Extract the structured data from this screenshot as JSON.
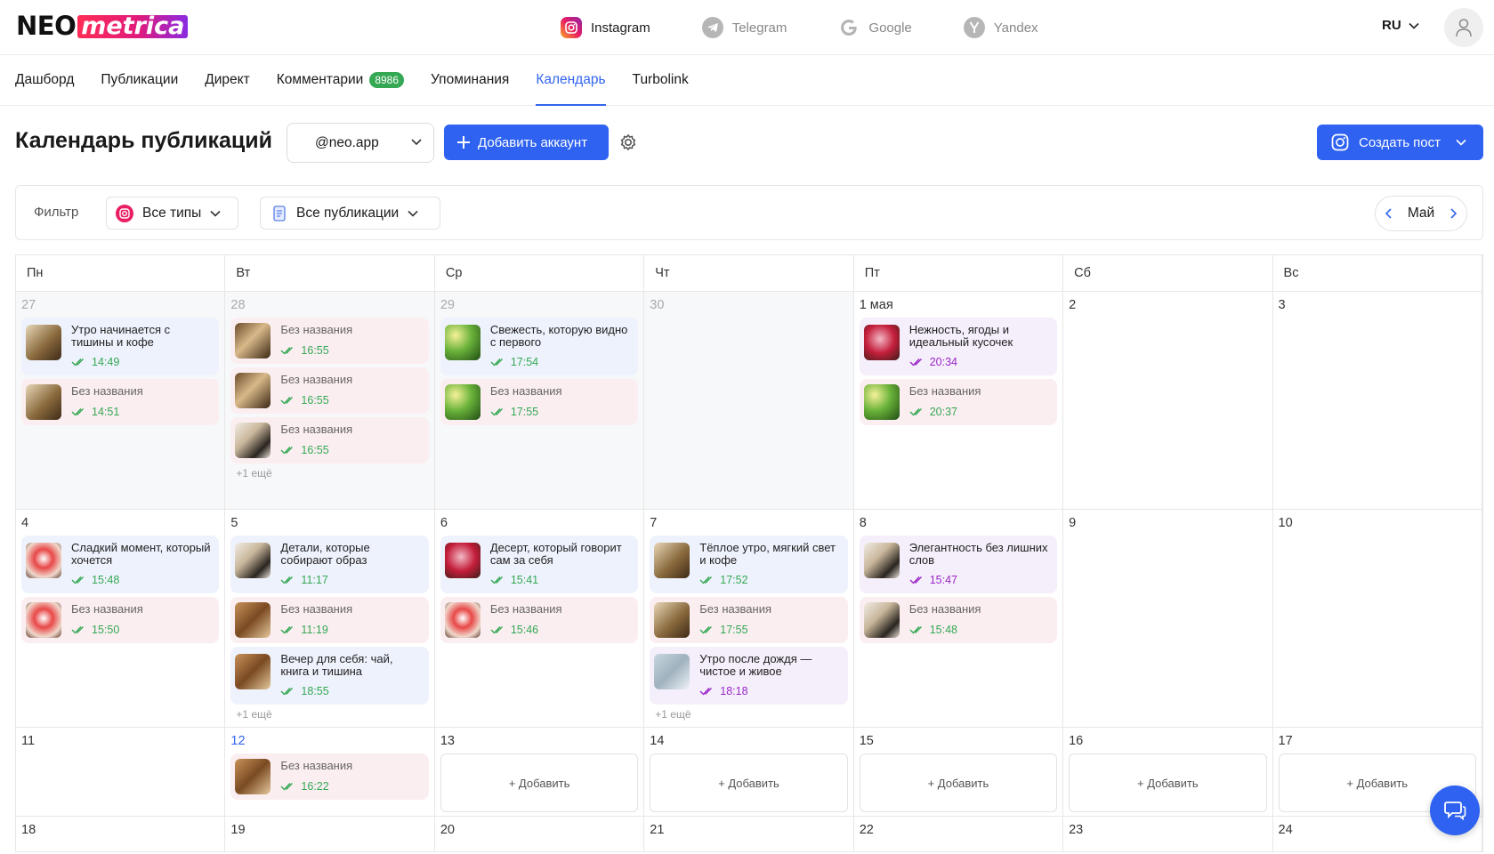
{
  "brand": {
    "part1": "NEO",
    "part2": "metrica"
  },
  "platforms": [
    {
      "label": "Instagram",
      "icon": "instagram-icon",
      "active": true
    },
    {
      "label": "Telegram",
      "icon": "telegram-icon"
    },
    {
      "label": "Google",
      "icon": "google-icon"
    },
    {
      "label": "Yandex",
      "icon": "yandex-icon"
    }
  ],
  "lang": "RU",
  "nav": {
    "dashboard": "Дашборд",
    "publications": "Публикации",
    "direct": "Директ",
    "comments": "Комментарии",
    "comments_badge": "8986",
    "mentions": "Упоминания",
    "calendar": "Календарь",
    "turbolink": "Turbolink"
  },
  "page": {
    "title": "Календарь публикаций",
    "account": "@neo.app",
    "add_account": "Добавить аккаунт",
    "create_post": "Создать пост"
  },
  "filter": {
    "label": "Фильтр",
    "types": "Все типы",
    "pubs": "Все публикации",
    "month": "Май"
  },
  "weekdays": [
    "Пн",
    "Вт",
    "Ср",
    "Чт",
    "Пт",
    "Сб",
    "Вс"
  ],
  "weeks": [
    {
      "height": "h1",
      "days": [
        {
          "n": "27",
          "past": true,
          "posts": [
            {
              "title": "Утро начинается с тишины и кофе",
              "time": "14:49",
              "tone": "blue",
              "thumb": "coffee"
            },
            {
              "title": "Без названия",
              "time": "14:51",
              "tone": "pink",
              "thumb": "coffee",
              "noname": true
            }
          ]
        },
        {
          "n": "28",
          "past": true,
          "more": "+1 ещё",
          "posts": [
            {
              "title": "Без названия",
              "time": "16:55",
              "tone": "pink",
              "thumb": "coffee2",
              "noname": true
            },
            {
              "title": "Без названия",
              "time": "16:55",
              "tone": "pink",
              "thumb": "coffee2",
              "noname": true
            },
            {
              "title": "Без названия",
              "time": "16:55",
              "tone": "pink",
              "thumb": "glasses",
              "noname": true
            }
          ]
        },
        {
          "n": "29",
          "past": true,
          "posts": [
            {
              "title": "Свежесть, которую видно с первого",
              "time": "17:54",
              "tone": "blue",
              "thumb": "leaf"
            },
            {
              "title": "Без названия",
              "time": "17:55",
              "tone": "pink",
              "thumb": "leaf",
              "noname": true
            }
          ]
        },
        {
          "n": "30",
          "past": true,
          "posts": []
        },
        {
          "n": "1 мая",
          "posts": [
            {
              "title": "Нежность, ягоды и идеальный кусочек",
              "time": "20:34",
              "tone": "purple",
              "thumb": "cake",
              "purple": true
            },
            {
              "title": "Без названия",
              "time": "20:37",
              "tone": "pink",
              "thumb": "leaf",
              "noname": true
            }
          ]
        },
        {
          "n": "2",
          "posts": []
        },
        {
          "n": "3",
          "posts": []
        }
      ]
    },
    {
      "height": "h2",
      "days": [
        {
          "n": "4",
          "posts": [
            {
              "title": "Сладкий момент, который хочется",
              "time": "15:48",
              "tone": "blue",
              "thumb": "straw"
            },
            {
              "title": "Без названия",
              "time": "15:50",
              "tone": "pink",
              "thumb": "straw",
              "noname": true
            }
          ]
        },
        {
          "n": "5",
          "more": "+1 ещё",
          "posts": [
            {
              "title": "Детали, которые собирают образ",
              "time": "11:17",
              "tone": "blue",
              "thumb": "glasses"
            },
            {
              "title": "Без названия",
              "time": "11:19",
              "tone": "pink",
              "thumb": "book",
              "noname": true
            },
            {
              "title": "Вечер для себя: чай, книга и тишина",
              "time": "18:55",
              "tone": "blue",
              "thumb": "book"
            }
          ]
        },
        {
          "n": "6",
          "posts": [
            {
              "title": "Десерт, который говорит сам за себя",
              "time": "15:41",
              "tone": "blue",
              "thumb": "cake"
            },
            {
              "title": "Без названия",
              "time": "15:46",
              "tone": "pink",
              "thumb": "straw",
              "noname": true
            }
          ]
        },
        {
          "n": "7",
          "more": "+1 ещё",
          "posts": [
            {
              "title": "Тёплое утро, мягкий свет и кофе",
              "time": "17:52",
              "tone": "blue",
              "thumb": "coffee"
            },
            {
              "title": "Без названия",
              "time": "17:55",
              "tone": "pink",
              "thumb": "coffee",
              "noname": true
            },
            {
              "title": "Утро после дождя — чистое и живое",
              "time": "18:18",
              "tone": "purple",
              "thumb": "rain",
              "purple": true
            }
          ]
        },
        {
          "n": "8",
          "posts": [
            {
              "title": "Элегантность без лишних слов",
              "time": "15:47",
              "tone": "purple",
              "thumb": "glasses",
              "purple": true
            },
            {
              "title": "Без названия",
              "time": "15:48",
              "tone": "pink",
              "thumb": "glasses",
              "noname": true
            }
          ]
        },
        {
          "n": "9",
          "posts": []
        },
        {
          "n": "10",
          "posts": []
        }
      ]
    },
    {
      "height": "h3",
      "days": [
        {
          "n": "11",
          "posts": []
        },
        {
          "n": "12",
          "today": true,
          "posts": [
            {
              "title": "Без названия",
              "time": "16:22",
              "tone": "pink",
              "thumb": "book",
              "noname": true
            }
          ]
        },
        {
          "n": "13",
          "add": "+ Добавить",
          "posts": []
        },
        {
          "n": "14",
          "add": "+ Добавить",
          "posts": []
        },
        {
          "n": "15",
          "add": "+ Добавить",
          "posts": []
        },
        {
          "n": "16",
          "add": "+ Добавить",
          "posts": []
        },
        {
          "n": "17",
          "add": "+ Добавить",
          "posts": []
        }
      ]
    },
    {
      "height": "h4",
      "days": [
        {
          "n": "18",
          "posts": []
        },
        {
          "n": "19",
          "posts": []
        },
        {
          "n": "20",
          "posts": []
        },
        {
          "n": "21",
          "posts": []
        },
        {
          "n": "22",
          "posts": []
        },
        {
          "n": "23",
          "posts": []
        },
        {
          "n": "24",
          "posts": []
        }
      ]
    }
  ]
}
